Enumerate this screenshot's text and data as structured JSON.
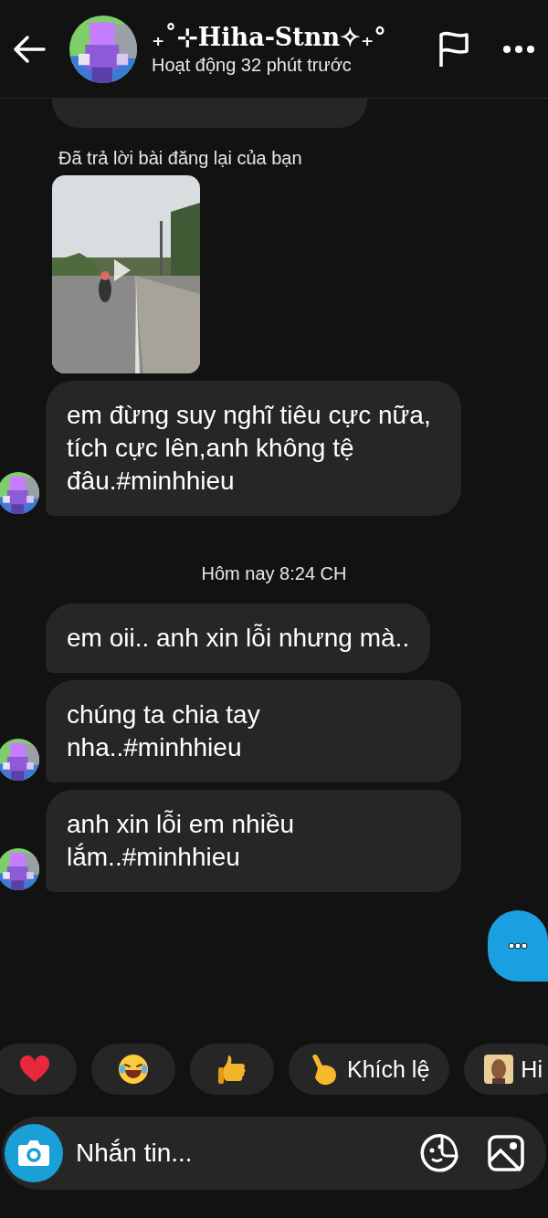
{
  "header": {
    "title": "₊˚⊹Hiha-Stnn✧₊°",
    "status": "Hoạt động 32 phút trước"
  },
  "messages": [
    {
      "kind": "cut_bubble"
    },
    {
      "kind": "reply_note",
      "text": "Đã trả lời bài đăng lại của bạn"
    },
    {
      "kind": "post_preview"
    },
    {
      "kind": "text",
      "text": "em đừng suy nghĩ tiêu cực nữa, tích cực lên,anh không tệ đâu.#minhhieu",
      "avatar": true
    },
    {
      "kind": "time",
      "text": "Hôm nay 8:24 CH"
    },
    {
      "kind": "text",
      "text": "em oii.. anh xin lỗi nhưng mà..",
      "avatar": false
    },
    {
      "kind": "text",
      "text": "chúng ta chia tay nha..#minhhieu",
      "avatar": true
    },
    {
      "kind": "text",
      "text": "anh xin lỗi em nhiều lắm..#minhhieu",
      "avatar": true
    },
    {
      "kind": "typing"
    }
  ],
  "quick_replies": [
    {
      "kind": "heart"
    },
    {
      "kind": "laugh"
    },
    {
      "kind": "thumbs_up"
    },
    {
      "kind": "pointing",
      "label": "Khích lệ"
    },
    {
      "kind": "sticker",
      "label": "Hi"
    }
  ],
  "composer": {
    "placeholder": "Nhắn tin..."
  }
}
